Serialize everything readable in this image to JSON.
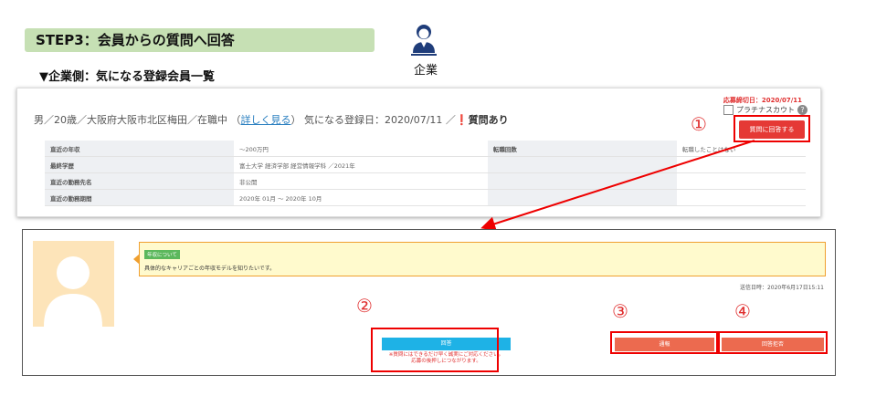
{
  "step": {
    "title": "STEP3：会員からの質問へ回答"
  },
  "section": {
    "subtitle": "▼企業側：気になる登録会員一覧"
  },
  "persona": {
    "label": "企業",
    "icon": "business-person-icon"
  },
  "top_panel": {
    "deadline": "応募締切日：2020/07/11",
    "platinum_label": "プラチナスカウト",
    "profile_prefix": "男／20歳／大阪府大阪市北区梅田／在職中",
    "profile_link": "詳しく見る",
    "registered": "気になる登録日：2020/07/11",
    "question_flag": "質問あり",
    "annotation": "①",
    "answer_button": "質問に回答する",
    "rows": [
      {
        "k1": "直近の年収",
        "v1": "～200万円",
        "k2": "転職回数",
        "v2": "転職したことはない"
      },
      {
        "k1": "最終学歴",
        "v1": "富士大学 経済学部 経営情報学科 ／2021年",
        "k2": "",
        "v2": ""
      },
      {
        "k1": "直近の勤務先名",
        "v1": "非公開",
        "k2": "",
        "v2": ""
      },
      {
        "k1": "直近の勤務期間",
        "v1": "2020年 01月 ～ 2020年 10月",
        "k2": "",
        "v2": ""
      }
    ]
  },
  "bottom_panel": {
    "tag": "年収について",
    "message": "具体的なキャリアごとの年収モデルを知りたいです。",
    "sent": "送信日時：2020年6月17日15:11",
    "annotations": [
      "②",
      "③",
      "④"
    ],
    "answer_button": "回答",
    "warning_line1": "※質問にはできるだけ早く誠実にご対応ください。",
    "warning_line2": "応募の後押しにつながります。",
    "report_button": "通報",
    "reject_button": "回答拒否"
  }
}
